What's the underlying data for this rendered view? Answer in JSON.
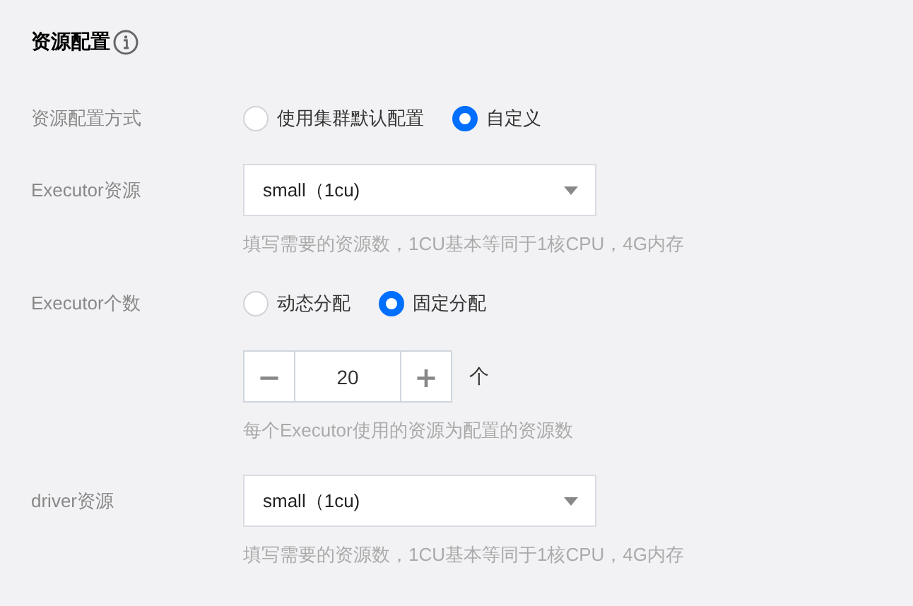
{
  "section": {
    "title": "资源配置"
  },
  "rows": [
    {
      "label": "资源配置方式",
      "items": [
        {
          "kind": "radio",
          "options": [
            {
              "label": "使用集群默认配置",
              "selected": false
            },
            {
              "label": "自定义",
              "selected": true
            }
          ]
        }
      ]
    },
    {
      "label": "Executor资源",
      "items": [
        {
          "kind": "select",
          "value": "small（1cu)"
        },
        {
          "kind": "hint",
          "text": "填写需要的资源数，1CU基本等同于1核CPU，4G内存"
        }
      ]
    },
    {
      "label": "Executor个数",
      "items": [
        {
          "kind": "radio",
          "options": [
            {
              "label": "动态分配",
              "selected": false
            },
            {
              "label": "固定分配",
              "selected": true
            }
          ]
        },
        {
          "kind": "stepper",
          "minus": "−",
          "value": "20",
          "plus": "+",
          "unit": "个"
        },
        {
          "kind": "hint",
          "text": "每个Executor使用的资源为配置的资源数"
        }
      ]
    },
    {
      "label": "driver资源",
      "items": [
        {
          "kind": "select",
          "value": "small（1cu)"
        },
        {
          "kind": "hint",
          "text": "填写需要的资源数，1CU基本等同于1核CPU，4G内存"
        }
      ]
    }
  ]
}
